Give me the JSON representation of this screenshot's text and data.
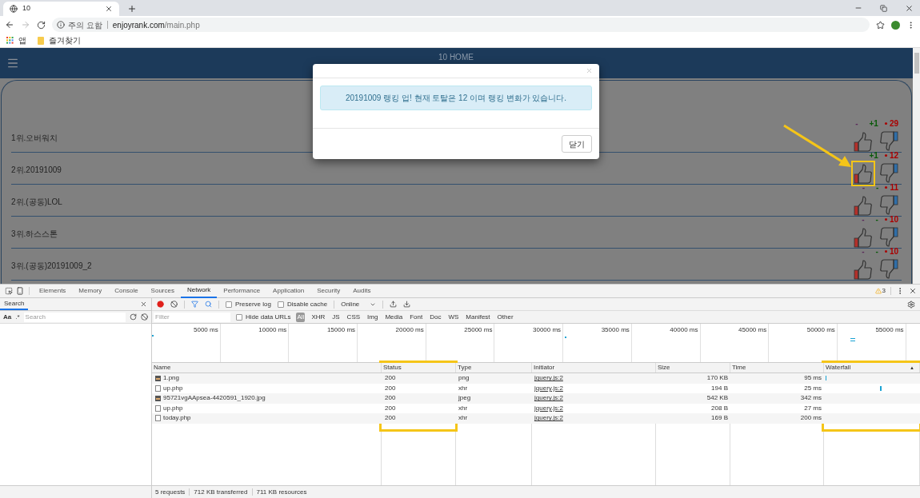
{
  "browser": {
    "tab": {
      "title": "10"
    },
    "address": {
      "security_label": "주의 요함",
      "host": "enjoyrank.com",
      "path": "/main.php"
    },
    "bookmarks": [
      {
        "kind": "apps",
        "label": "앱"
      },
      {
        "kind": "folder",
        "label": "즐겨찾기"
      }
    ]
  },
  "site": {
    "title": "10 HOME",
    "rankings": [
      {
        "label": "1위.오버워치",
        "rank_change": "-",
        "vote_change": "+1",
        "score": "29",
        "highlighted": false
      },
      {
        "label": "2위.20191009",
        "vote_change": "+1",
        "score": "12",
        "highlighted": true
      },
      {
        "label": "2위.(공동)LOL",
        "rank_change": "-",
        "vote_change": "-",
        "score": "11",
        "highlighted": false
      },
      {
        "label": "3위.하스스톤",
        "rank_change": "-",
        "vote_change": "-",
        "score": "10",
        "highlighted": false
      },
      {
        "label": "3위.(공동)20191009_2",
        "rank_change": "-",
        "vote_change": "-",
        "score": "10",
        "highlighted": false
      }
    ]
  },
  "modal": {
    "message": "20191009 랭킹 업! 현재 토탈은 12 이며 랭킹 변화가 있습니다.",
    "close_button": "닫기"
  },
  "devtools": {
    "tabs": [
      {
        "label": "Elements",
        "selected": false
      },
      {
        "label": "Memory",
        "selected": false
      },
      {
        "label": "Console",
        "selected": false
      },
      {
        "label": "Sources",
        "selected": false
      },
      {
        "label": "Network",
        "selected": true
      },
      {
        "label": "Performance",
        "selected": false
      },
      {
        "label": "Application",
        "selected": false
      },
      {
        "label": "Security",
        "selected": false
      },
      {
        "label": "Audits",
        "selected": false
      }
    ],
    "warnings": "3",
    "sidebar": {
      "tab": "Search",
      "case_label": "Aa",
      "regex_label": ".*",
      "search_placeholder": "Search"
    },
    "toolbar": {
      "preserve_log": {
        "label": "Preserve log",
        "checked": false
      },
      "disable_cache": {
        "label": "Disable cache",
        "checked": false
      },
      "throttling": "Online"
    },
    "filter": {
      "placeholder": "Filter",
      "hide_data_urls": {
        "label": "Hide data URLs",
        "checked": false
      },
      "types": [
        {
          "label": "All",
          "selected": true
        },
        {
          "label": "XHR",
          "selected": false
        },
        {
          "label": "JS",
          "selected": false
        },
        {
          "label": "CSS",
          "selected": false
        },
        {
          "label": "Img",
          "selected": false
        },
        {
          "label": "Media",
          "selected": false
        },
        {
          "label": "Font",
          "selected": false
        },
        {
          "label": "Doc",
          "selected": false
        },
        {
          "label": "WS",
          "selected": false
        },
        {
          "label": "Manifest",
          "selected": false
        },
        {
          "label": "Other",
          "selected": false
        }
      ]
    },
    "overview_ticks": [
      "5000 ms",
      "10000 ms",
      "15000 ms",
      "20000 ms",
      "25000 ms",
      "30000 ms",
      "35000 ms",
      "40000 ms",
      "45000 ms",
      "50000 ms",
      "55000 ms"
    ],
    "table": {
      "columns": [
        {
          "label": "Name",
          "highlighted": false
        },
        {
          "label": "Status",
          "highlighted": true
        },
        {
          "label": "Type",
          "highlighted": false
        },
        {
          "label": "Initiator",
          "highlighted": false
        },
        {
          "label": "Size",
          "highlighted": false
        },
        {
          "label": "Time",
          "highlighted": false
        },
        {
          "label": "Waterfall",
          "highlighted": true,
          "sort_indicator": "▲"
        }
      ],
      "rows": [
        {
          "kind": "image",
          "name": "1.png",
          "status": "200",
          "type": "png",
          "initiator": "jquery.js:2",
          "size": "170 KB",
          "time": "95 ms"
        },
        {
          "kind": "document",
          "name": "up.php",
          "status": "200",
          "type": "xhr",
          "initiator": "jquery.js:2",
          "size": "194 B",
          "time": "25 ms"
        },
        {
          "kind": "image",
          "name": "95721vgAApsea-4420591_1920.jpg",
          "status": "200",
          "type": "jpeg",
          "initiator": "jquery.js:2",
          "size": "542 KB",
          "time": "342 ms"
        },
        {
          "kind": "document",
          "name": "up.php",
          "status": "200",
          "type": "xhr",
          "initiator": "jquery.js:2",
          "size": "208 B",
          "time": "27 ms"
        },
        {
          "kind": "document",
          "name": "today.php",
          "status": "200",
          "type": "xhr",
          "initiator": "jquery.js:2",
          "size": "169 B",
          "time": "200 ms"
        }
      ]
    },
    "status_bar": [
      "5 requests",
      "712 KB transferred",
      "711 KB resources"
    ]
  }
}
